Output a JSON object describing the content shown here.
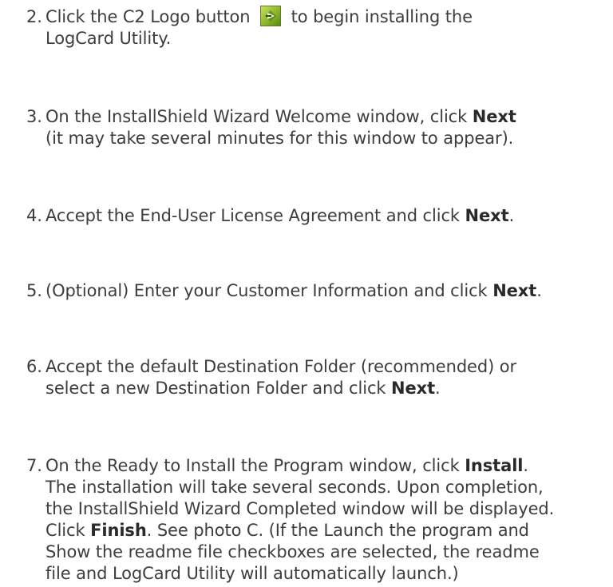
{
  "steps": [
    {
      "num": "2.",
      "lines": [
        {
          "pre": "Click the C2 Logo button",
          "post": "to begin installing the"
        },
        {
          "text": "LogCard Utility."
        }
      ],
      "icon": "c2-logo-icon"
    },
    {
      "num": "3.",
      "lines": [
        {
          "pre": "On the InstallShield Wizard Welcome window, click ",
          "bold": "Next",
          "post": ""
        },
        {
          "text": "(it may take several minutes for this window to appear)."
        }
      ]
    },
    {
      "num": "4.",
      "lines": [
        {
          "pre": "Accept the End-User License Agreement and click ",
          "bold": "Next",
          "post": "."
        }
      ]
    },
    {
      "num": "5.",
      "lines": [
        {
          "pre": "(Optional) Enter your Customer Information and click ",
          "bold": "Next",
          "post": "."
        }
      ]
    },
    {
      "num": "6.",
      "lines": [
        {
          "text": "Accept the default Destination Folder (recommended) or"
        },
        {
          "pre": "select a new Destination Folder and click ",
          "bold": "Next",
          "post": "."
        }
      ]
    },
    {
      "num": "7.",
      "lines": [
        {
          "pre": "On the Ready to Install the Program window, click ",
          "bold": "Install",
          "post": "."
        },
        {
          "text": "The installation will take several seconds. Upon completion,"
        },
        {
          "text": "the InstallShield Wizard Completed window will be displayed."
        },
        {
          "pre": "Click ",
          "bold": "Finish",
          "post": ". See photo C. (If the Launch the program and"
        },
        {
          "text": "Show the readme file checkboxes are selected, the readme"
        },
        {
          "text": "file and LogCard Utility will automatically launch.)"
        }
      ]
    }
  ]
}
